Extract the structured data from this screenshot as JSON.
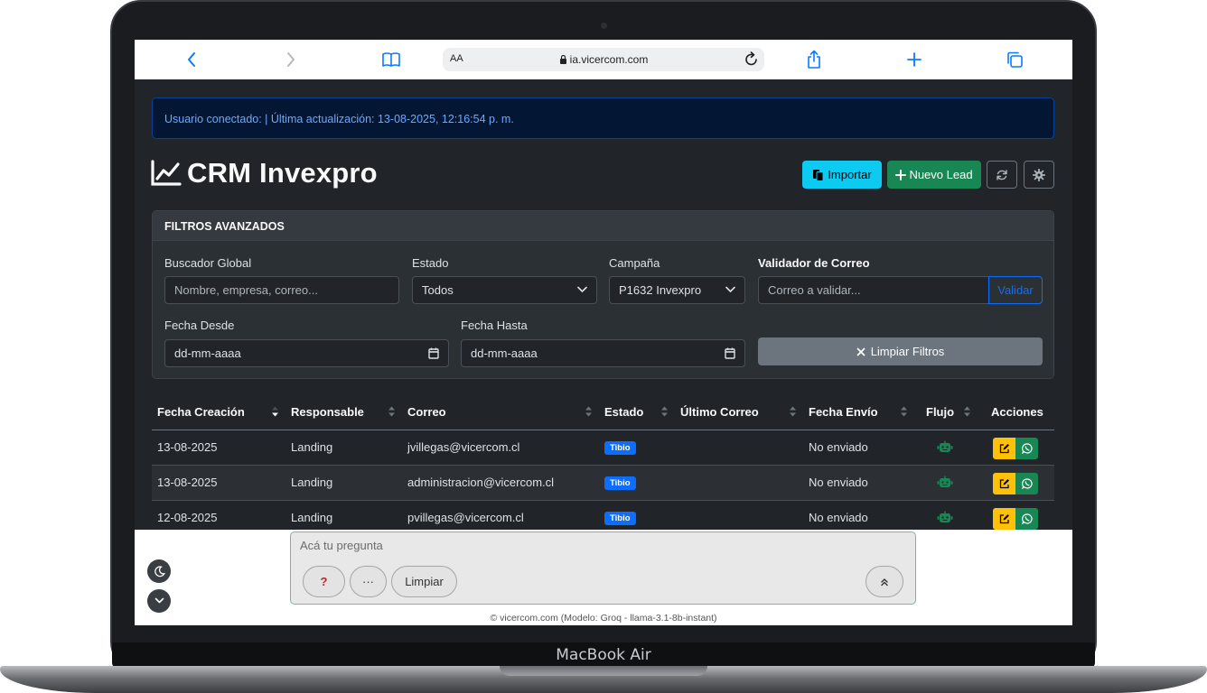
{
  "device": {
    "label": "MacBook Air"
  },
  "browser": {
    "text_size_label": "AA",
    "url": "ia.vicercom.com"
  },
  "status_alert": "Usuario conectado: | Última actualización: 13-08-2025, 12:16:54 p. m.",
  "app": {
    "title": "CRM Invexpro"
  },
  "toolbar": {
    "import_label": "Importar",
    "new_lead_label": "Nuevo Lead"
  },
  "filters": {
    "heading": "FILTROS AVANZADOS",
    "global_search": {
      "label": "Buscador Global",
      "placeholder": "Nombre, empresa, correo..."
    },
    "status": {
      "label": "Estado",
      "value": "Todos"
    },
    "campaign": {
      "label": "Campaña",
      "value": "P1632 Invexpro"
    },
    "email_validator": {
      "label": "Validador de Correo",
      "placeholder": "Correo a validar...",
      "button": "Validar"
    },
    "date_from": {
      "label": "Fecha Desde",
      "placeholder": "dd-mm-aaaa"
    },
    "date_to": {
      "label": "Fecha Hasta",
      "placeholder": "dd-mm-aaaa"
    },
    "clear_label": "Limpiar Filtros"
  },
  "table": {
    "headers": [
      "Fecha Creación",
      "Responsable",
      "Correo",
      "Estado",
      "Último Correo",
      "Fecha Envío",
      "Flujo",
      "Acciones"
    ],
    "rows": [
      {
        "date": "13-08-2025",
        "owner": "Landing",
        "email": "jvillegas@vicercom.cl",
        "status": "Tibio",
        "last_email": "",
        "sent": "No enviado",
        "flow_icon": "robot-icon",
        "flow_color": "#198754"
      },
      {
        "date": "13-08-2025",
        "owner": "Landing",
        "email": "administracion@vicercom.cl",
        "status": "Tibio",
        "last_email": "",
        "sent": "No enviado",
        "flow_icon": "robot-icon",
        "flow_color": "#198754"
      },
      {
        "date": "12-08-2025",
        "owner": "Landing",
        "email": "pvillegas@vicercom.cl",
        "status": "Tibio",
        "last_email": "",
        "sent": "No enviado",
        "flow_icon": "robot-icon",
        "flow_color": "#198754"
      }
    ]
  },
  "chat": {
    "placeholder": "Acá tu pregunta",
    "help_label": "?",
    "more_label": "···",
    "clear_label": "Limpiar",
    "footer": "© vicercom.com (Modelo: Groq - llama-3.1-8b-instant)"
  },
  "colors": {
    "info": "#0dcaf0",
    "success": "#198754",
    "warning": "#ffc107",
    "primary": "#0d6efd",
    "secondary": "#6c757d",
    "page_bg": "#212529"
  }
}
